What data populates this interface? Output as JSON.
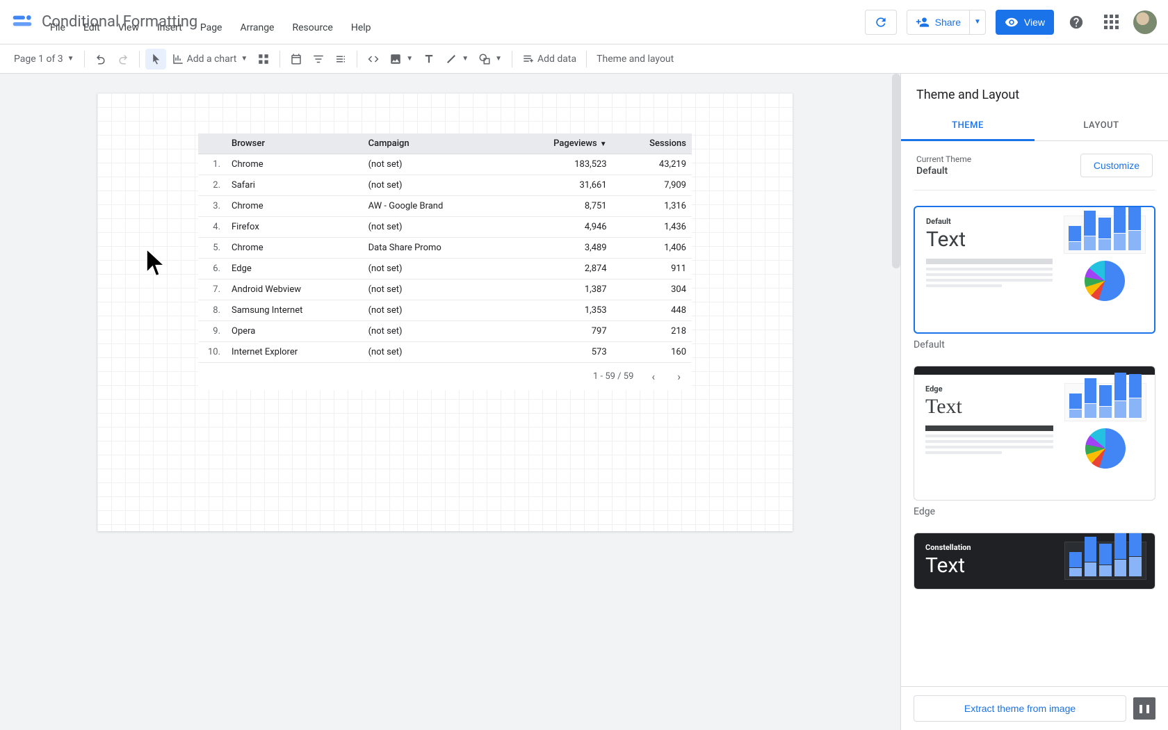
{
  "header": {
    "title": "Conditional Formatting",
    "refresh_tooltip": "Refresh",
    "share_label": "Share",
    "view_label": "View"
  },
  "menubar": {
    "items": [
      "File",
      "Edit",
      "View",
      "Insert",
      "Page",
      "Arrange",
      "Resource",
      "Help"
    ]
  },
  "toolbar": {
    "page_label": "Page 1 of 3",
    "add_chart_label": "Add a chart",
    "add_data_label": "Add data",
    "theme_layout_label": "Theme and layout"
  },
  "table": {
    "columns": [
      "",
      "Browser",
      "Campaign",
      "Pageviews",
      "Sessions"
    ],
    "sort_column": "Pageviews",
    "sort_dir": "desc",
    "rows": [
      {
        "idx": "1.",
        "browser": "Chrome",
        "campaign": "(not set)",
        "pageviews": "183,523",
        "sessions": "43,219"
      },
      {
        "idx": "2.",
        "browser": "Safari",
        "campaign": "(not set)",
        "pageviews": "31,661",
        "sessions": "7,909"
      },
      {
        "idx": "3.",
        "browser": "Chrome",
        "campaign": "AW - Google Brand",
        "pageviews": "8,751",
        "sessions": "1,316"
      },
      {
        "idx": "4.",
        "browser": "Firefox",
        "campaign": "(not set)",
        "pageviews": "4,946",
        "sessions": "1,436"
      },
      {
        "idx": "5.",
        "browser": "Chrome",
        "campaign": "Data Share Promo",
        "pageviews": "3,489",
        "sessions": "1,406"
      },
      {
        "idx": "6.",
        "browser": "Edge",
        "campaign": "(not set)",
        "pageviews": "2,874",
        "sessions": "911"
      },
      {
        "idx": "7.",
        "browser": "Android Webview",
        "campaign": "(not set)",
        "pageviews": "1,387",
        "sessions": "304"
      },
      {
        "idx": "8.",
        "browser": "Samsung Internet",
        "campaign": "(not set)",
        "pageviews": "1,353",
        "sessions": "448"
      },
      {
        "idx": "9.",
        "browser": "Opera",
        "campaign": "(not set)",
        "pageviews": "797",
        "sessions": "218"
      },
      {
        "idx": "10.",
        "browser": "Internet Explorer",
        "campaign": "(not set)",
        "pageviews": "573",
        "sessions": "160"
      }
    ],
    "pager": "1 - 59 / 59"
  },
  "sidebar": {
    "title": "Theme and Layout",
    "tabs": {
      "theme": "THEME",
      "layout": "LAYOUT"
    },
    "active_tab": "theme",
    "current_label": "Current Theme",
    "current_name": "Default",
    "customize_label": "Customize",
    "themes": [
      {
        "name": "Default",
        "selected": true
      },
      {
        "name": "Edge",
        "selected": false
      },
      {
        "name": "Constellation",
        "selected": false
      }
    ],
    "extract_label": "Extract theme from image"
  }
}
